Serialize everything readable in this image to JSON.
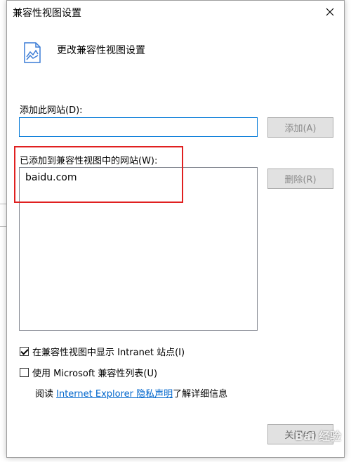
{
  "dialog": {
    "title": "兼容性视图设置",
    "header_text": "更改兼容性视图设置"
  },
  "add_section": {
    "label": "添加此网站(D):",
    "input_value": "",
    "add_button": "添加(A)"
  },
  "list_section": {
    "label": "已添加到兼容性视图中的网站(W):",
    "sites": [
      "baidu.com"
    ],
    "remove_button": "删除(R)"
  },
  "options": {
    "intranet": {
      "label": "在兼容性视图中显示 Intranet 站点(I)",
      "checked": true
    },
    "ms_list": {
      "label": "使用 Microsoft 兼容性列表(U)",
      "checked": false
    }
  },
  "read_line": {
    "prefix": "阅读 ",
    "link": "Internet Explorer 隐私声明",
    "suffix": "了解详细信息"
  },
  "footer": {
    "close_button": "关闭(C)"
  },
  "watermark": "Bai 经验",
  "colors": {
    "highlight": "#e02020",
    "link": "#0066cc",
    "input_border": "#0078d7"
  }
}
